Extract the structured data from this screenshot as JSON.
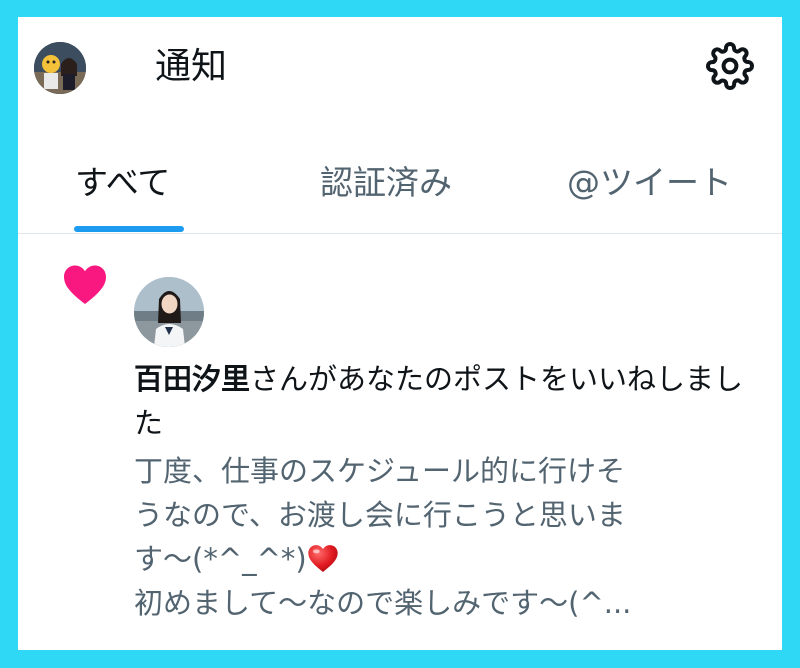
{
  "header": {
    "title": "通知",
    "avatar_icon": "user-avatar",
    "settings_icon": "gear-icon"
  },
  "tabs": [
    {
      "label": "すべて",
      "active": true
    },
    {
      "label": "認証済み",
      "active": false
    },
    {
      "label": "@ツイート",
      "active": false
    }
  ],
  "notification": {
    "type_icon": "heart-icon",
    "type_color": "#f91880",
    "user_name": "百田汐里",
    "action_text": "さんがあなたのポストをいいねしました",
    "preview_lines": [
      "丁度、仕事のスケジュール的に行けそ",
      "うなので、お渡し会に行こうと思いま",
      "す〜(*^_^*)",
      "初めまして〜なので楽しみです〜(^..."
    ],
    "emoji_icon": "red-heart-emoji"
  },
  "colors": {
    "background_border": "#2fd8f5",
    "accent": "#1d9bf0",
    "like": "#f91880",
    "text_primary": "#0f1419",
    "text_secondary": "#536471"
  }
}
